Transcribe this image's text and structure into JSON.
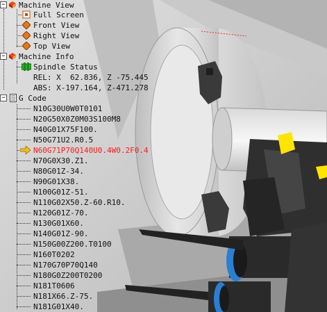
{
  "tree": {
    "machine_view": {
      "label": "Machine View",
      "items": [
        "Full Screen",
        "Front View",
        "Right View",
        "Top View"
      ]
    },
    "machine_info": {
      "label": "Machine Info",
      "spindle_status": "Spindle Status",
      "rel": "REL: X  62.836, Z -75.445",
      "abs": "ABS: X-197.164, Z-471.278"
    },
    "gcode": {
      "label": "G Code",
      "current_index": 4,
      "lines": [
        "N10G30U0W0T0101",
        "N20G50X0Z0M03S100M8",
        "N40G01X75F100.",
        "N50G71U2.R0.5",
        "N60G71P70Q140U0.4W0.2F0.4",
        "N70G0X30.Z1.",
        "N80G01Z-34.",
        "N90G01X38.",
        "N100G01Z-51.",
        "N110G02X50.Z-60.R10.",
        "N120G01Z-70.",
        "N130G01X60.",
        "N140G01Z-90.",
        "N150G00Z200.T0100",
        "N160T0202",
        "N170G70P70Q140",
        "N180G0Z200T0200",
        "N181T0606",
        "N181X66.Z-75.",
        "N181G01X40."
      ]
    }
  },
  "colors": {
    "current_line": "#ff1a1a",
    "pointer_arrow": "#f0c020",
    "tool_accent": "#ffe400",
    "tool_holder_blue": "#2a7fd0"
  }
}
